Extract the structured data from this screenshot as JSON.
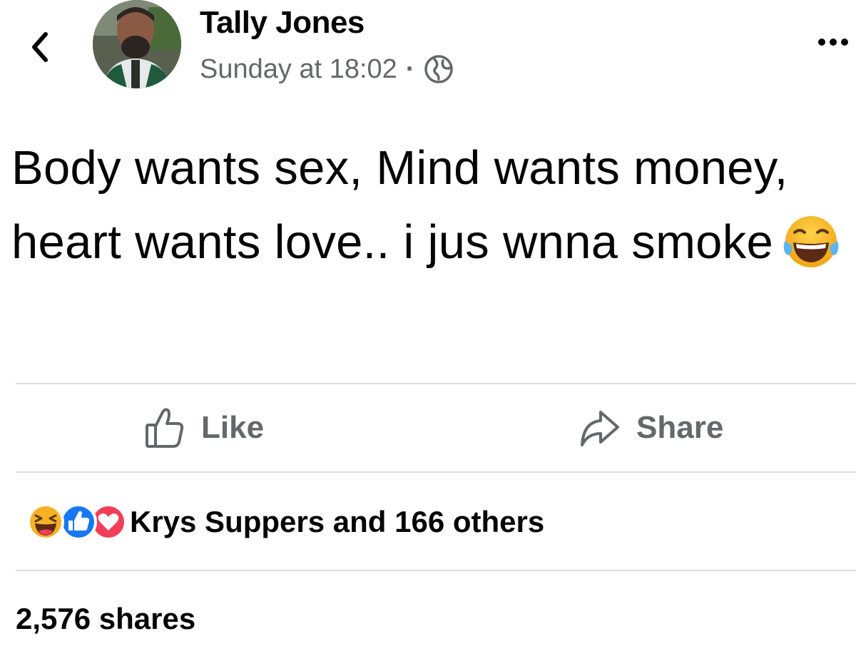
{
  "post": {
    "author_name": "Tally Jones",
    "timestamp": "Sunday at 18:02",
    "separator": "·",
    "audience_icon": "globe-icon",
    "text": "Body wants sex, Mind wants money, heart wants love.. i jus wnna smoke",
    "text_emoji": "face-with-tears-of-joy"
  },
  "header": {
    "back_icon": "chevron-left-icon",
    "more_icon": "more-horizontal-icon"
  },
  "actions": {
    "like_label": "Like",
    "share_label": "Share"
  },
  "reactions": {
    "types": [
      "haha",
      "like",
      "love"
    ],
    "summary": "Krys Suppers and 166 others"
  },
  "shares": {
    "label": "2,576 shares"
  },
  "colors": {
    "text_primary": "#050505",
    "text_secondary": "#65676b",
    "like_blue": "#1877f2",
    "love_red": "#f33e58",
    "haha_yellow": "#f7b125",
    "divider": "#dcdde0"
  }
}
